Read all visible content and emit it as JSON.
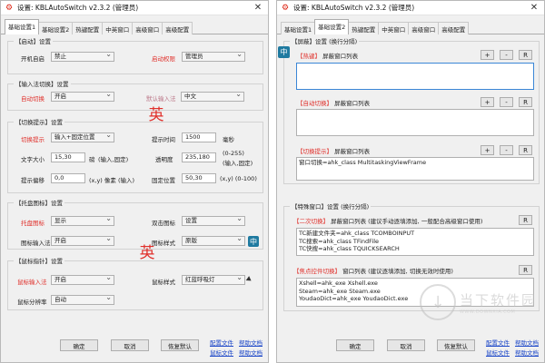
{
  "left_window": {
    "title": "设置:  KBLAutoSwitch v2.3.2 (管理员)",
    "tabs": [
      "基础设置1",
      "基础设置2",
      "热键配置",
      "中英窗口",
      "高级窗口",
      "高级配置"
    ],
    "active_tab": 0,
    "startup_group": {
      "title": "【启动】设置",
      "boot_label": "开机自启",
      "boot_value": "禁止",
      "priv_label": "启动权限",
      "priv_value": "管理员"
    },
    "ime_switch_group": {
      "title": "【输入法切换】设置",
      "auto_label": "自动切换",
      "auto_value": "开启",
      "default_label": "默认输入法",
      "default_value": "中文",
      "ime_indicator": "英"
    },
    "switch_tip_group": {
      "title": "【切换提示】设置",
      "tip_label": "切换提示",
      "tip_value": "输入+固定位置",
      "tip_time_label": "提示时间",
      "tip_time_value": "1500",
      "tip_time_unit": "毫秒",
      "font_size_label": "文字大小",
      "font_size_value": "15,30",
      "font_size_unit": "(输入,固定)",
      "font_size_sep": "磅",
      "opacity_label": "透明度",
      "opacity_value": "235,180",
      "opacity_hint_1": "(0-255)",
      "opacity_hint_2": "(输入,固定)",
      "offset_label": "提示偏移",
      "offset_value": "0,0",
      "offset_unit": "(x,y) 像素 (输入)",
      "fixed_pos_label": "固定位置",
      "fixed_pos_value": "50,30",
      "fixed_pos_unit": "(x,y) (0-100)"
    },
    "tray_group": {
      "title": "【托盘图标】设置",
      "tray_label": "托盘图标",
      "tray_value": "显示",
      "dbl_label": "双击图标",
      "dbl_value": "设置",
      "icon_ime_label": "图标输入法",
      "icon_ime_value": "开启",
      "icon_style_label": "图标样式",
      "icon_style_value": "原版",
      "icon_preview": "中"
    },
    "mouse_group": {
      "title": "【鼠标指针】设置",
      "mouse_ime_label": "鼠标输入法",
      "mouse_ime_value": "开启",
      "mouse_style_label": "鼠标样式",
      "mouse_style_value": "红蓝呼吸灯",
      "mouse_indicator": "英",
      "dpi_label": "鼠标分辨率",
      "dpi_value": "自动"
    },
    "buttons": {
      "ok": "确定",
      "cancel": "取消",
      "restore": "恢复默认"
    },
    "links": {
      "config_file": "配置文件",
      "help_doc": "帮助文档",
      "mouse_file": "鼠标文件",
      "help_doc2": "帮助文档"
    }
  },
  "right_window": {
    "title": "设置:  KBLAutoSwitch v2.3.2 (管理员)",
    "tabs": [
      "基础设置1",
      "基础设置2",
      "热键配置",
      "中英窗口",
      "高级窗口",
      "高级配置"
    ],
    "active_tab": 1,
    "screen_group": {
      "title": "【屏蔽】设置 (换行分隔)",
      "ime_badge": "中",
      "hotkey_tag": "【热键】",
      "hotkey_label": "屏蔽窗口列表",
      "hotkey_list": "",
      "autoswitch_tag": "【自动切换】",
      "autoswitch_label": "屏蔽窗口列表",
      "autoswitch_list": "",
      "switchtip_tag": "【切换提示】",
      "switchtip_label": "屏蔽窗口列表",
      "switchtip_list": "窗口切换=ahk_class MultitaskingViewFrame"
    },
    "special_group": {
      "title": "【特殊窗口】设置 (换行分隔)",
      "second_tag": "【二次切换】",
      "second_label": "屏蔽窗口列表 (建议手动逐填添加, 一般配合高级窗口使用)",
      "second_list": [
        "TC新建文件夹=ahk_class TCOMBOINPUT",
        "TC搜索=ahk_class TFindFile",
        "TC快搜=ahk_class TQUICKSEARCH"
      ],
      "focus_tag": "【焦点控件切换】",
      "focus_label": "窗口列表 (建议逐填添加, 切换无效时使用)",
      "focus_list": [
        "Xshell=ahk_exe Xshell.exe",
        "Steam=ahk_exe Steam.exe",
        "YoudaoDict=ahk_exe YoudaoDict.exe"
      ]
    },
    "small_buttons": {
      "plus": "+",
      "minus": "-",
      "reset": "R"
    },
    "buttons": {
      "ok": "确定",
      "cancel": "取消",
      "restore": "恢复默认"
    },
    "links": {
      "config_file": "配置文件",
      "help_doc": "帮助文档",
      "mouse_file": "鼠标文件",
      "help_doc2": "帮助文档"
    },
    "watermark": {
      "logo_glyph": "↓",
      "cn": "当下软件园",
      "en": "WWW.DOWNXIA.COM"
    }
  }
}
